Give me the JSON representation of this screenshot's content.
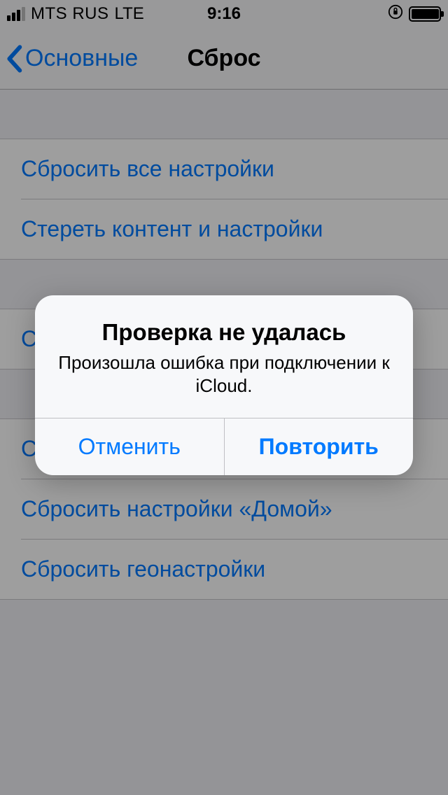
{
  "status": {
    "carrier": "MTS RUS",
    "network": "LTE",
    "time": "9:16"
  },
  "nav": {
    "back_label": "Основные",
    "title": "Сброс"
  },
  "groups": [
    {
      "items": [
        {
          "label": "Сбросить все настройки"
        },
        {
          "label": "Стереть контент и настройки"
        }
      ]
    },
    {
      "items": [
        {
          "label": "Сбросить настройки сети"
        }
      ]
    },
    {
      "items": [
        {
          "label": "Сбросить словарь клавиатуры"
        },
        {
          "label": "Сбросить настройки «Домой»"
        },
        {
          "label": "Сбросить геонастройки"
        }
      ]
    }
  ],
  "alert": {
    "title": "Проверка не удалась",
    "message": "Произошла ошибка при подключении к iCloud.",
    "cancel": "Отменить",
    "retry": "Повторить"
  }
}
